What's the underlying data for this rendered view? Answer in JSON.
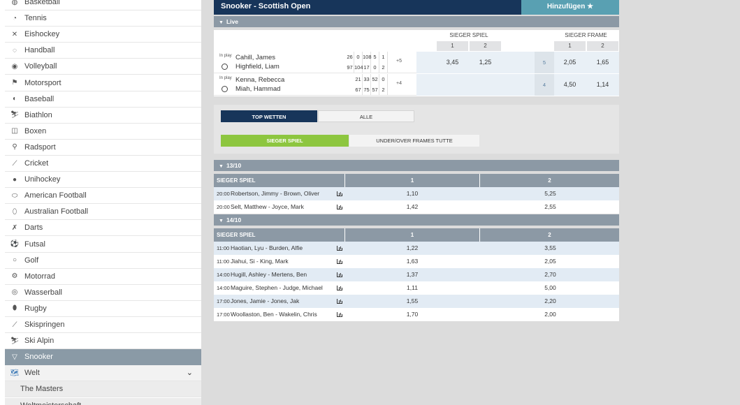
{
  "sidebar": {
    "items": [
      {
        "label": "Basketball",
        "icon": "basketball-icon"
      },
      {
        "label": "Tennis",
        "icon": "tennis-icon"
      },
      {
        "label": "Eishockey",
        "icon": "hockey-icon"
      },
      {
        "label": "Handball",
        "icon": "handball-icon"
      },
      {
        "label": "Volleyball",
        "icon": "volleyball-icon"
      },
      {
        "label": "Motorsport",
        "icon": "motorsport-icon"
      },
      {
        "label": "Baseball",
        "icon": "baseball-icon"
      },
      {
        "label": "Biathlon",
        "icon": "biathlon-icon"
      },
      {
        "label": "Boxen",
        "icon": "boxing-icon"
      },
      {
        "label": "Radsport",
        "icon": "cycling-icon"
      },
      {
        "label": "Cricket",
        "icon": "cricket-icon"
      },
      {
        "label": "Unihockey",
        "icon": "unihockey-icon"
      },
      {
        "label": "American Football",
        "icon": "american-football-icon"
      },
      {
        "label": "Australian Football",
        "icon": "australian-football-icon"
      },
      {
        "label": "Darts",
        "icon": "darts-icon"
      },
      {
        "label": "Futsal",
        "icon": "futsal-icon"
      },
      {
        "label": "Golf",
        "icon": "golf-icon"
      },
      {
        "label": "Motorrad",
        "icon": "motorbike-icon"
      },
      {
        "label": "Wasserball",
        "icon": "waterpolo-icon"
      },
      {
        "label": "Rugby",
        "icon": "rugby-icon"
      },
      {
        "label": "Skispringen",
        "icon": "skijump-icon"
      },
      {
        "label": "Ski Alpin",
        "icon": "ski-icon"
      },
      {
        "label": "Snooker",
        "icon": "snooker-icon"
      }
    ],
    "region": "Welt",
    "subitems": [
      "The Masters",
      "Weltmeisterschaft"
    ]
  },
  "header": {
    "title": "Snooker - Scottish Open",
    "add_label": "Hinzufügen ★"
  },
  "live": {
    "section_label": "Live",
    "sieger_spiel_label": "SIEGER SPIEL",
    "sieger_frame_label": "SIEGER FRAME",
    "col1": "1",
    "col2": "2",
    "inplay_label": "In play",
    "matches": [
      {
        "player1": "Cahill, James",
        "player2": "Highfield, Liam",
        "scores1": [
          "26",
          "0",
          "108",
          "5",
          "1"
        ],
        "scores2": [
          "97",
          "104",
          "17",
          "0",
          "2"
        ],
        "more": "+5",
        "spiel1": "3,45",
        "spiel2": "1,25",
        "frame_num": "5",
        "frame1": "2,05",
        "frame2": "1,65"
      },
      {
        "player1": "Kenna, Rebecca",
        "player2": "Miah, Hammad",
        "scores1": [
          "21",
          "33",
          "52",
          "0"
        ],
        "scores2": [
          "67",
          "75",
          "57",
          "2"
        ],
        "more": "+4",
        "spiel1": "",
        "spiel2": "",
        "frame_num": "4",
        "frame1": "4,50",
        "frame2": "1,14"
      }
    ]
  },
  "tabs": {
    "top": "TOP WETTEN",
    "alle": "ALLE",
    "sieger": "SIEGER SPIEL",
    "under": "UNDER/OVER FRAMES TUTTE"
  },
  "days": [
    {
      "date": "13/10",
      "market": "SIEGER SPIEL",
      "c1": "1",
      "c2": "2",
      "rows": [
        {
          "time": "20:00",
          "match": "Robertson, Jimmy - Brown, Oliver",
          "o1": "1,10",
          "o2": "5,25"
        },
        {
          "time": "20:00",
          "match": "Selt, Matthew - Joyce, Mark",
          "o1": "1,42",
          "o2": "2,55"
        }
      ]
    },
    {
      "date": "14/10",
      "market": "SIEGER SPIEL",
      "c1": "1",
      "c2": "2",
      "rows": [
        {
          "time": "11:00",
          "match": "Haotian, Lyu - Burden, Alfie",
          "o1": "1,22",
          "o2": "3,55"
        },
        {
          "time": "11:00",
          "match": "Jiahui, Si - King, Mark",
          "o1": "1,63",
          "o2": "2,05"
        },
        {
          "time": "14:00",
          "match": "Hugill, Ashley - Mertens, Ben",
          "o1": "1,37",
          "o2": "2,70"
        },
        {
          "time": "14:00",
          "match": "Maguire, Stephen - Judge, Michael",
          "o1": "1,11",
          "o2": "5,00"
        },
        {
          "time": "17:00",
          "match": "Jones, Jamie - Jones, Jak",
          "o1": "1,55",
          "o2": "2,20"
        },
        {
          "time": "17:00",
          "match": "Woollaston, Ben - Wakelin, Chris",
          "o1": "1,70",
          "o2": "2,00"
        }
      ]
    }
  ]
}
